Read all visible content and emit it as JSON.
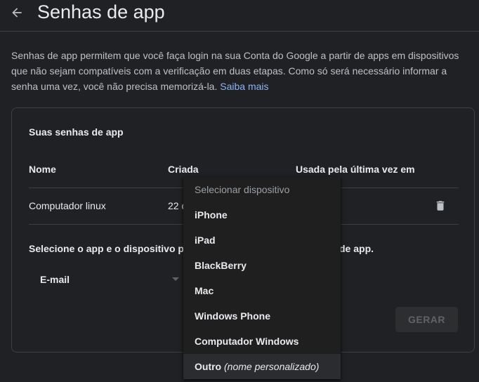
{
  "header": {
    "title": "Senhas de app"
  },
  "description": {
    "text": "Senhas de app permitem que você faça login na sua Conta do Google a partir de apps em dispositivos que não sejam compatíveis com a verificação em duas etapas. Como só será necessário informar a senha uma vez, você não precisa memorizá-la.",
    "link_label": "Saiba mais"
  },
  "card": {
    "title": "Suas senhas de app",
    "columns": [
      "Nome",
      "Criada",
      "Usada pela última vez em"
    ],
    "rows": [
      {
        "name": "Computador linux",
        "created": "22 d"
      }
    ],
    "select_prompt": "Selecione o app e o dispositivo pa",
    "select_prompt_tail": "de app.",
    "app_select_value": "E-mail",
    "generate_label": "GERAR"
  },
  "dropdown": {
    "placeholder": "Selecionar dispositivo",
    "options": [
      "iPhone",
      "iPad",
      "BlackBerry",
      "Mac",
      "Windows Phone",
      "Computador Windows"
    ],
    "other_label": "Outro",
    "other_hint": "(nome personalizado)"
  },
  "colors": {
    "background": "#202124",
    "text": "#e8eaed",
    "link": "#8ab4f8",
    "border": "#3c4043"
  },
  "icons": {
    "back": "arrow-back-icon",
    "delete": "trash-icon",
    "select": "caret-down-icon"
  }
}
